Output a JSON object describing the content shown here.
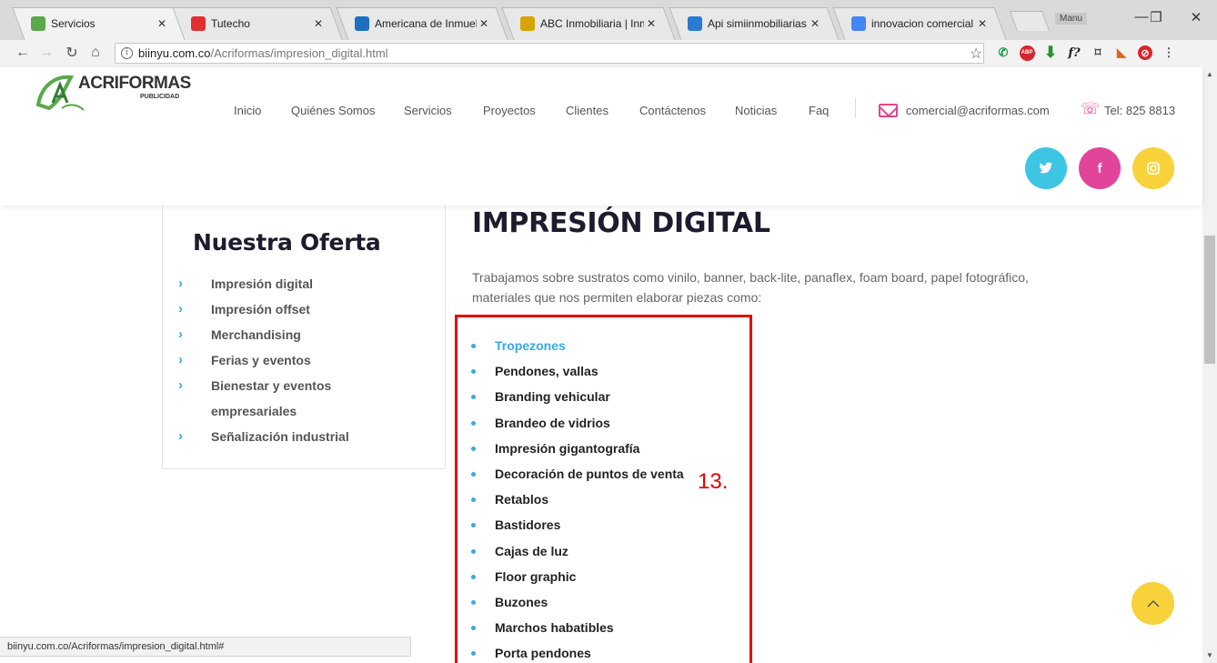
{
  "browser": {
    "tabs": [
      {
        "title": "Servicios",
        "icon": "acriformas-favicon",
        "color": "#5aa84a",
        "active": true
      },
      {
        "title": "Tutecho",
        "icon": "tutecho-favicon",
        "color": "#e03030",
        "active": false
      },
      {
        "title": "Americana de Inmueble",
        "icon": "americana-favicon",
        "color": "#1e6fc4",
        "active": false
      },
      {
        "title": "ABC Inmobiliaria | Inmu",
        "icon": "abc-favicon",
        "color": "#d8a400",
        "active": false
      },
      {
        "title": "Api simiinmobiliarias",
        "icon": "api-favicon",
        "color": "#2a7bd1",
        "active": false
      },
      {
        "title": "innovacion comercial - ",
        "icon": "google-favicon",
        "color": "#4285f4",
        "active": false
      }
    ],
    "user_badge": "Manu",
    "url_host": "biinyu.com.co",
    "url_path": "/Acriformas/impresion_digital.html",
    "status_url": "biinyu.com.co/Acriformas/impresion_digital.html#"
  },
  "header": {
    "logo_text": "ACRIFORMAS",
    "logo_sub": "PUBLICIDAD",
    "menu": [
      "Inicio",
      "Quiénes Somos",
      "Servicios",
      "Proyectos",
      "Clientes",
      "Contáctenos",
      "Noticias",
      "Faq"
    ],
    "email": "comercial@acriformas.com",
    "phone": "Tel: 825 8813",
    "social": [
      {
        "name": "twitter",
        "glyph": "🐦",
        "color": "#3cc6e3"
      },
      {
        "name": "facebook",
        "glyph": "f",
        "color": "#e2449a"
      },
      {
        "name": "instagram",
        "glyph": "◎",
        "color": "#f7d23a"
      }
    ]
  },
  "sidebar": {
    "title": "Nuestra Oferta",
    "items": [
      "Impresión digital",
      "Impresión offset",
      "Merchandising",
      "Ferias y eventos",
      "Bienestar y eventos empresariales",
      "Señalización industrial"
    ]
  },
  "main": {
    "title": "IMPRESIÓN DIGITAL",
    "intro": "Trabajamos sobre sustratos como vinilo, banner, back-lite, panaflex, foam board, papel fotográfico, materiales que nos permiten elaborar piezas como:",
    "items": [
      "Tropezones",
      "Pendones, vallas",
      "Branding vehicular",
      "Brandeo de vidrios",
      "Impresión gigantografía",
      "Decoración de puntos de venta",
      "Retablos",
      "Bastidores",
      "Cajas de luz",
      "Floor graphic",
      "Buzones",
      "Marchos habatibles",
      "Porta pendones"
    ],
    "active_item": "Tropezones"
  },
  "annotation": "13.",
  "colors": {
    "accent_blue": "#3aa9e0",
    "accent_pink": "#e0468e",
    "annotation_red": "#e30000",
    "back_to_top": "#f7d23a"
  }
}
